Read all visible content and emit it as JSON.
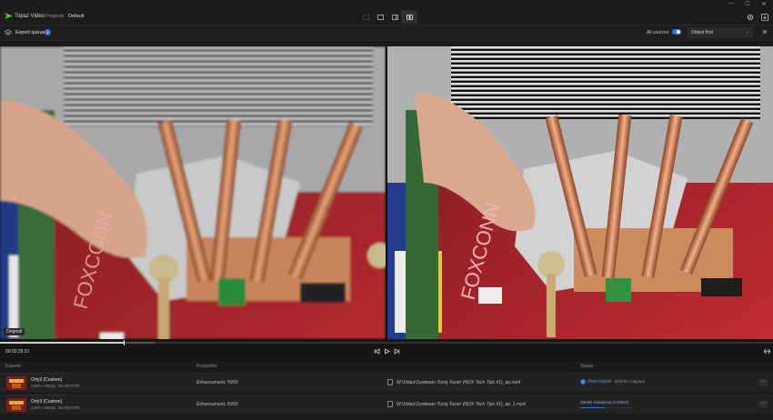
{
  "app": {
    "name": "Topaz Video",
    "breadcrumb": [
      "Projects",
      "/",
      "Default"
    ],
    "accent": "#3b6fd9",
    "logo_color": "#5cc441"
  },
  "window_controls": [
    "minimize-icon",
    "maximize-icon",
    "close-icon"
  ],
  "view_modes": [
    "single-view-icon",
    "split-view-icon",
    "side-by-side-icon",
    "compare-icon"
  ],
  "active_view": "compare-icon",
  "queue": {
    "title": "Export queue",
    "badge": "1",
    "sources_label": "All sources",
    "sources_toggle": true,
    "sort_value": "Oldest first"
  },
  "preview": {
    "left_label": "Original",
    "left_brand_text": "FOXCONN",
    "right_brand_text": "FOXCONN"
  },
  "transport": {
    "timecode": "00:02:25:21",
    "progress": 0.16,
    "buffered": 0.2
  },
  "exports": {
    "columns": [
      "Exports",
      "Properties",
      "Status"
    ],
    "rows": [
      {
        "model": "Orty3 (Custom)",
        "spec": "1280 × 960px, 30.000 FPS",
        "properties": "Enhancement, H265",
        "file": "W:\\Video\\Sunbeam Tuniq Tower (NOX Tech Tips #1)_ap.mp4",
        "status_link": "View export",
        "status_text": "· 00h03m elapsed",
        "done": true
      },
      {
        "model": "Orty3 (Custom)",
        "spec": "1280 × 960px, 30.000 FPS",
        "properties": "Enhancement, H265",
        "file": "W:\\Video\\Sunbeam Tuniq Tower (NOX Tech Tips #1)_ap_1.mp4",
        "status_text": "02m0s remaining (0.03ms)",
        "progress": 0.45,
        "done": false
      }
    ]
  }
}
